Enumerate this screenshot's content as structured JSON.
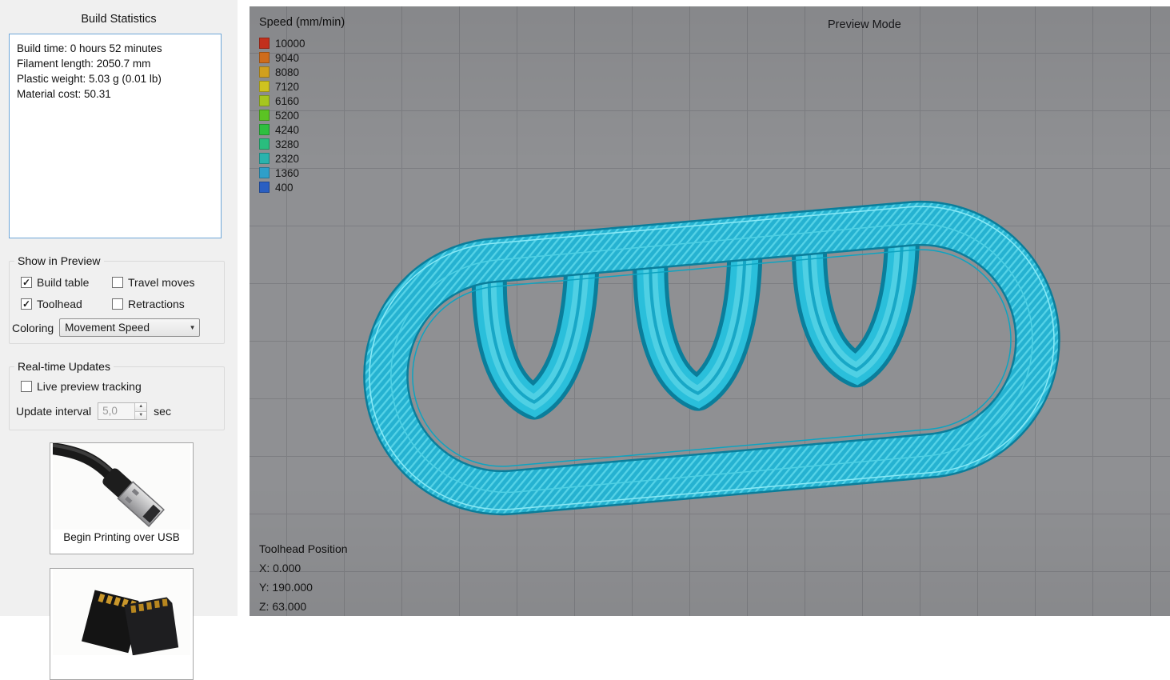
{
  "sidebar": {
    "build_statistics": {
      "title": "Build Statistics",
      "lines": [
        "Build time: 0 hours 52 minutes",
        "Filament length: 2050.7 mm",
        "Plastic weight: 5.03 g (0.01 lb)",
        "Material cost: 50.31"
      ]
    },
    "show_in_preview": {
      "title": "Show in Preview",
      "checkboxes": [
        {
          "id": "build-table",
          "label": "Build table",
          "checked": true
        },
        {
          "id": "travel-moves",
          "label": "Travel moves",
          "checked": false
        },
        {
          "id": "toolhead",
          "label": "Toolhead",
          "checked": true
        },
        {
          "id": "retractions",
          "label": "Retractions",
          "checked": false
        }
      ],
      "coloring_label": "Coloring",
      "coloring_value": "Movement Speed"
    },
    "realtime_updates": {
      "title": "Real-time Updates",
      "live_preview": {
        "label": "Live preview tracking",
        "checked": false
      },
      "update_interval_label": "Update interval",
      "update_interval_value": "5,0",
      "update_interval_unit": "sec"
    },
    "buttons": {
      "usb_label": "Begin Printing over USB",
      "usb_image": "usb-cable-photo",
      "sd_image": "sd-cards-photo"
    }
  },
  "viewport": {
    "mode_label": "Preview Mode",
    "legend": {
      "title": "Speed (mm/min)",
      "entries": [
        {
          "value": "10000",
          "color": "#c2301d"
        },
        {
          "value": "9040",
          "color": "#cf6c1b"
        },
        {
          "value": "8080",
          "color": "#d1a01e"
        },
        {
          "value": "7120",
          "color": "#cfc31f"
        },
        {
          "value": "6160",
          "color": "#a6c620"
        },
        {
          "value": "5200",
          "color": "#5bc323"
        },
        {
          "value": "4240",
          "color": "#2fbf3f"
        },
        {
          "value": "3280",
          "color": "#2abd7e"
        },
        {
          "value": "2320",
          "color": "#2ab3ad"
        },
        {
          "value": "1360",
          "color": "#2f9fc9"
        },
        {
          "value": "400",
          "color": "#2a5fc2"
        }
      ]
    },
    "toolhead_position": {
      "title": "Toolhead Position",
      "x": "X: 0.000",
      "y": "Y: 190.000",
      "z": "Z: 63.000"
    },
    "model_color": "#2abfdb"
  }
}
